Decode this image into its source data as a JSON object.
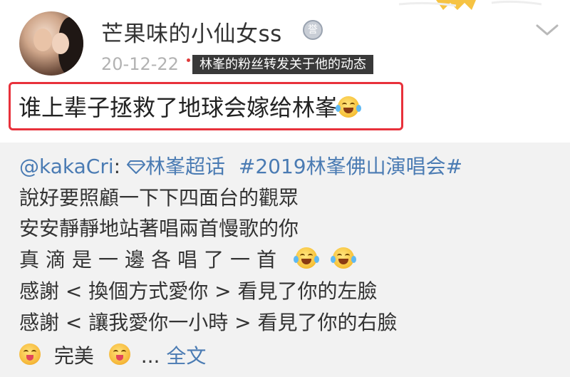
{
  "post": {
    "username": "芒果味的小仙女ss",
    "time": "20-12-22",
    "caption_overlay": "林峯的粉丝转发关于他的动态",
    "text": "谁上辈子拯救了地球会嫁给林峯",
    "emoji": "laugh-cry-emoji"
  },
  "repost": {
    "author": "@kakaCri",
    "colon": ":",
    "topic": "林峯超话",
    "hashtag": "#2019林峯佛山演唱会#",
    "lines": [
      "說好要照顧一下下四面台的觀眾",
      "安安靜靜地站著唱兩首慢歌的你",
      "真滴是一邊各唱了一首",
      "感謝 < 換個方式愛你 > 看見了你的左臉",
      "感謝 < 讓我愛你一小時 > 看見了你的右臉"
    ],
    "last_line_word": "完美",
    "ellipsis": "...",
    "full_text_link": "全文"
  },
  "colors": {
    "highlight_border": "#e8313b",
    "link_blue": "#4a7bb3",
    "repost_bg": "#f2f2f2",
    "time_gray": "#b2b2b2"
  }
}
